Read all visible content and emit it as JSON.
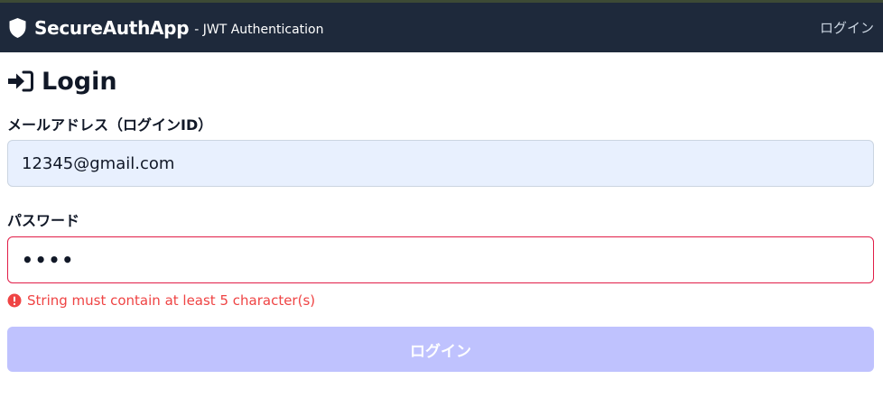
{
  "navbar": {
    "brand_name": "SecureAuthApp",
    "brand_subtitle": "- JWT Authentication",
    "login_link": "ログイン",
    "icon": "shield-icon"
  },
  "page": {
    "title": "Login",
    "title_icon": "sign-in-icon"
  },
  "form": {
    "email_label": "メールアドレス（ログインID）",
    "email_value": "12345@gmail.com",
    "password_label": "パスワード",
    "password_value": "1234",
    "password_error": "String must contain at least 5 character(s)",
    "submit_label": "ログイン"
  },
  "colors": {
    "navbar_bg": "#1e293b",
    "error": "#ef4444",
    "submit_disabled": "#bfc2fe",
    "email_bg": "#e8f0fe"
  }
}
